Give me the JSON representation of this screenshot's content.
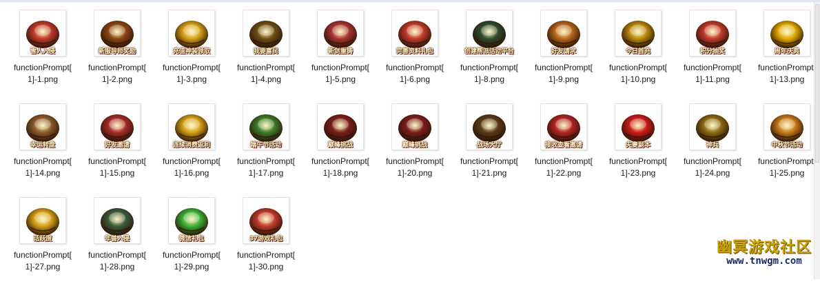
{
  "window": {
    "view_mode": "large-icons"
  },
  "files": [
    {
      "name": "functionPrompt[1]-1.png",
      "icon": "snowman-icon",
      "caption": "雪人入侵",
      "color": "#c0392b"
    },
    {
      "name": "functionPrompt[1]-2.png",
      "icon": "treasure-chest-icon",
      "caption": "新服导师奖励",
      "color": "#8b4513"
    },
    {
      "name": "functionPrompt[1]-3.png",
      "icon": "gold-gift-icon",
      "caption": "充值神装领取",
      "color": "#d4a017"
    },
    {
      "name": "functionPrompt[1]-4.png",
      "icon": "gold-ingot-icon",
      "caption": "我要富民",
      "color": "#6b4e16"
    },
    {
      "name": "functionPrompt[1]-5.png",
      "icon": "sword-icon",
      "caption": "新剑重铸",
      "color": "#a83232"
    },
    {
      "name": "functionPrompt[1]-6.png",
      "icon": "swirl-candy-icon",
      "caption": "完善资料礼包",
      "color": "#c0392b"
    },
    {
      "name": "functionPrompt[1]-8.png",
      "icon": "crossed-swords-icon",
      "caption": "创建帮派活动平台",
      "color": "#2e4a2e"
    },
    {
      "name": "functionPrompt[1]-9.png",
      "icon": "handshake-icon",
      "caption": "好友请求",
      "color": "#b5651d"
    },
    {
      "name": "functionPrompt[1]-10.png",
      "icon": "gift-box-icon",
      "caption": "今日首充",
      "color": "#b8860b"
    },
    {
      "name": "functionPrompt[1]-11.png",
      "icon": "coins-gift-icon",
      "caption": "积分抽奖",
      "color": "#c0392b"
    },
    {
      "name": "functionPrompt[1]-13.png",
      "icon": "gold-pile-icon",
      "caption": "周年庆典",
      "color": "#e0a800"
    },
    {
      "name": "functionPrompt[1]-14.png",
      "icon": "wheel-icon",
      "caption": "幸运转盘",
      "color": "#8b5a2b"
    },
    {
      "name": "functionPrompt[1]-15.png",
      "icon": "scroll-icon",
      "caption": "好友邀请",
      "color": "#a52a2a"
    },
    {
      "name": "functionPrompt[1]-16.png",
      "icon": "treasure-bowl-icon",
      "caption": "连续消费返利",
      "color": "#d4a017"
    },
    {
      "name": "functionPrompt[1]-17.png",
      "icon": "zongzi-icon",
      "caption": "端午节活动",
      "color": "#3c7a2a"
    },
    {
      "name": "functionPrompt[1]-18.png",
      "icon": "crossed-blades-icon",
      "caption": "巅峰挑战",
      "color": "#7a1c1c"
    },
    {
      "name": "functionPrompt[1]-20.png",
      "icon": "crossed-blades-icon",
      "caption": "巅峰挑战",
      "color": "#7a1c1c"
    },
    {
      "name": "functionPrompt[1]-21.png",
      "icon": "battle-shield-icon",
      "caption": "战场大厅",
      "color": "#5a3a1a"
    },
    {
      "name": "functionPrompt[1]-22.png",
      "icon": "red-gift-icon",
      "caption": "接收查看邀请",
      "color": "#b22222"
    },
    {
      "name": "functionPrompt[1]-23.png",
      "icon": "double-heart-icon",
      "caption": "夫妻副本",
      "color": "#cc1a1a"
    },
    {
      "name": "functionPrompt[1]-24.png",
      "icon": "divine-weapon-icon",
      "caption": "神兵",
      "color": "#8b6914"
    },
    {
      "name": "functionPrompt[1]-25.png",
      "icon": "mooncake-icon",
      "caption": "中秋节活动",
      "color": "#c47a1a"
    },
    {
      "name": "functionPrompt[1]-27.png",
      "icon": "gold-bar-icon",
      "caption": "活跃度",
      "color": "#d4a017"
    },
    {
      "name": "functionPrompt[1]-28.png",
      "icon": "beast-icon",
      "caption": "年兽入侵",
      "color": "#3a5a3a"
    },
    {
      "name": "functionPrompt[1]-29.png",
      "icon": "wechat-icon",
      "caption": "微信礼包",
      "color": "#3cb034"
    },
    {
      "name": "functionPrompt[1]-30.png",
      "icon": "gift-toy-icon",
      "caption": "37游戏礼包",
      "color": "#c0392b"
    }
  ],
  "watermark": {
    "title": "幽冥游戏社区",
    "url": "www.tnwgm.com"
  }
}
